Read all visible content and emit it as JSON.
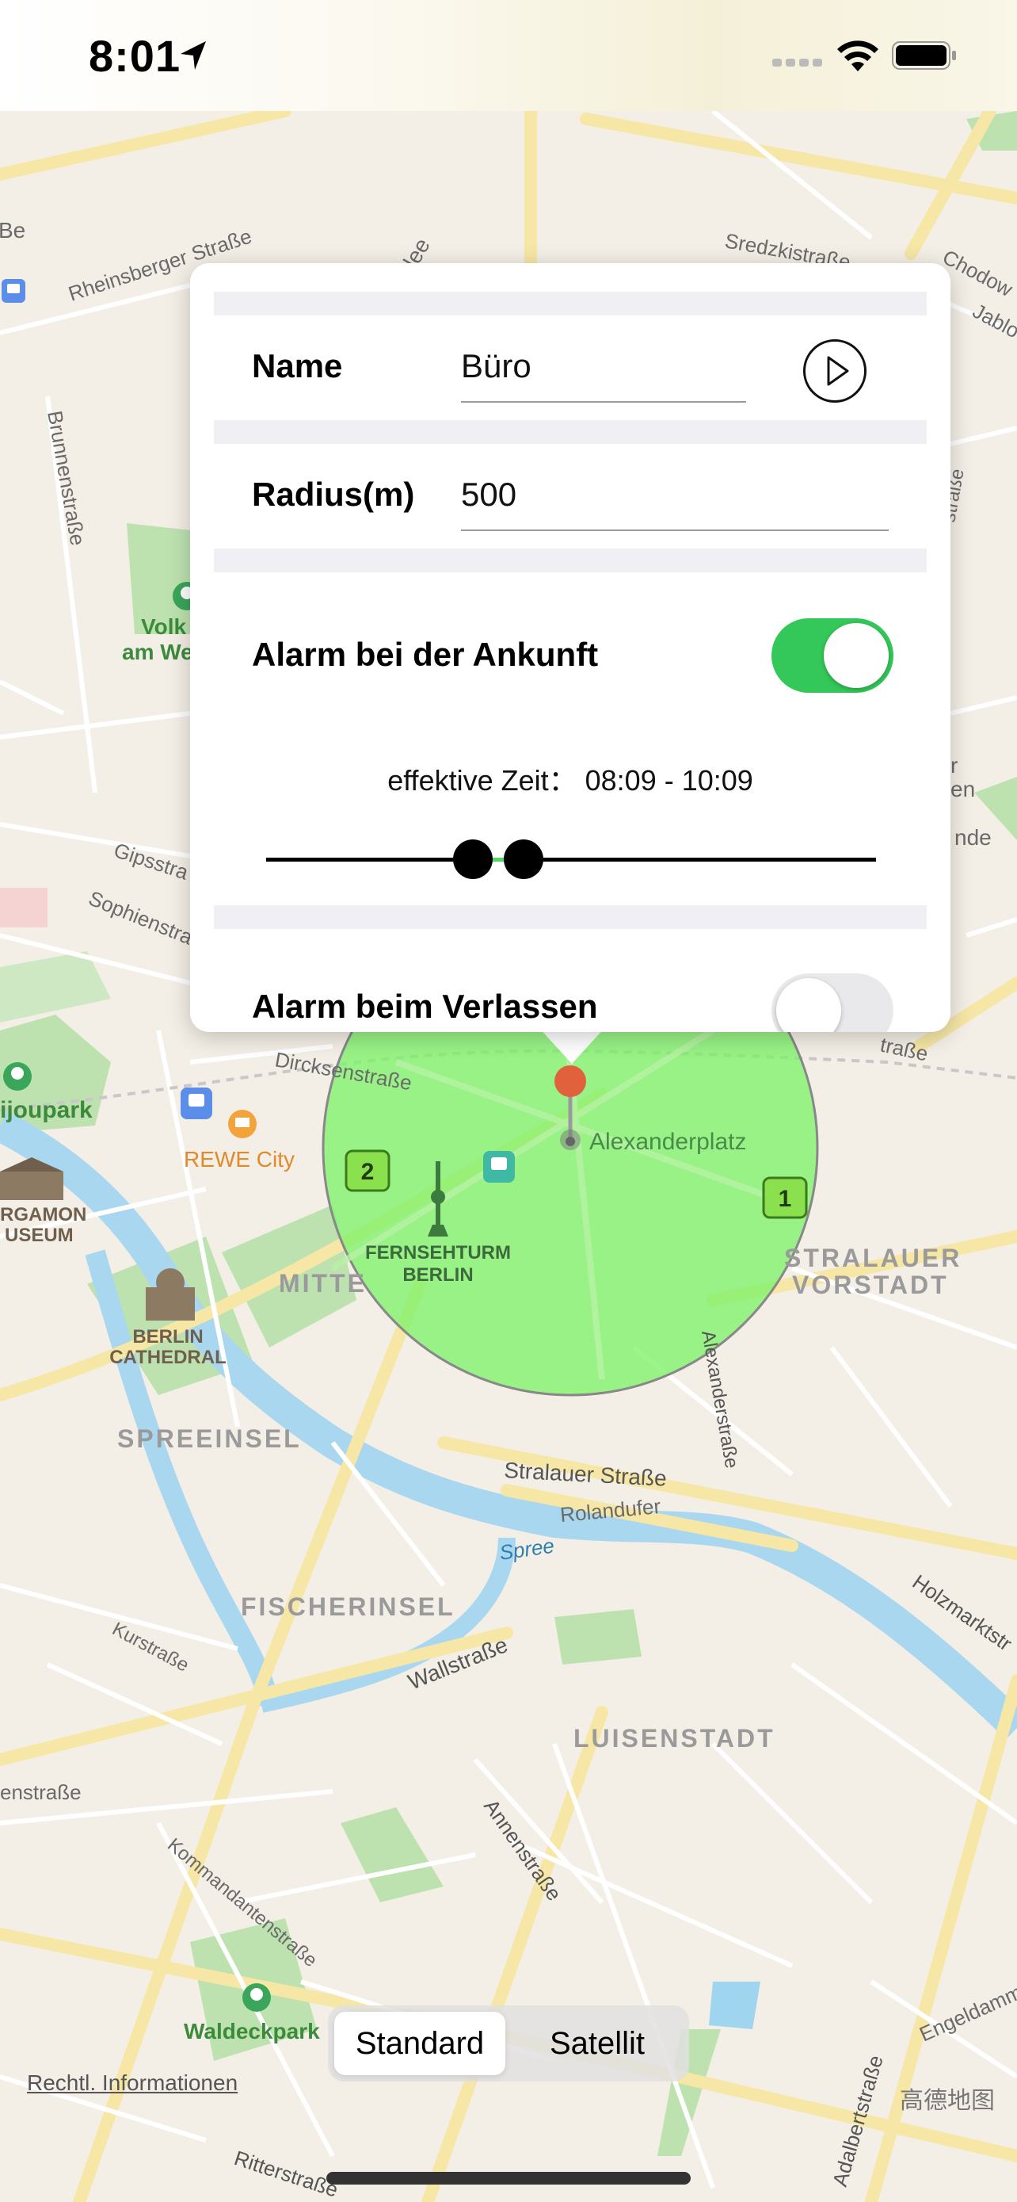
{
  "status_bar": {
    "time": "8:01"
  },
  "popup": {
    "name_label": "Name",
    "name_value": "Büro",
    "radius_label": "Radius(m)",
    "radius_value": "500",
    "arrival_label": "Alarm bei der Ankunft",
    "arrival_enabled": true,
    "effective_time": "effektive Zeit： 08:09 - 10:09",
    "departure_label": "Alarm beim Verlassen",
    "departure_enabled": false,
    "colors": {
      "toggle_on": "#34c759",
      "slider_fill": "#4cd964"
    }
  },
  "map": {
    "labels": {
      "rheinsberger": "Rheinsberger Straße",
      "sredzki": "Sredzkistraße",
      "chodo": "Chodow",
      "jablo": "Jablo",
      "brunnen": "Brunnenstraße",
      "volk1": "Volk",
      "volk2": "am We",
      "gips": "Gipsstra",
      "sophien": "Sophienstra",
      "dircksen": "Dircksenstraße",
      "monbijou": "ijoupark",
      "rewe": "REWE City",
      "alexanderplatz": "Alexanderplatz",
      "fernsehturm1": "FERNSEHTURM",
      "fernsehturm2": "BERLIN",
      "mitte": "MITTE",
      "stralauer_v1": "STRALAUER",
      "stralauer_v2": "VORSTADT",
      "pergamon1": "RGAMON",
      "pergamon2": "USEUM",
      "cathedral1": "BERLIN",
      "cathedral2": "CATHEDRAL",
      "spreeinsel": "SPREEINSEL",
      "stralauer_str": "Stralauer Straße",
      "rolandufer": "Rolandufer",
      "spree": "Spree",
      "alexanderstr": "Alexanderstraße",
      "fischerinsel": "FISCHERINSEL",
      "kurstr": "Kurstraße",
      "wallstr": "Wallstraße",
      "luisenstadt": "LUISENSTADT",
      "holzmarkt": "Holzmarktstr",
      "annenstr": "Annenstraße",
      "kommandanten": "Kommandantenstraße",
      "waldeckpark": "Waldeckpark",
      "engeldamm": "Engeldamm",
      "adalbert": "Adalbertstraße",
      "ritterstr": "Ritterstraße",
      "enstr": "enstraße",
      "stra_r": "straße",
      "nde": "nde",
      "r_en1": "r",
      "r_en2": "en",
      "be": "Be",
      "lee": "lee",
      "trasse_right": "traße",
      "amap": "高德地图"
    },
    "badge_1": "1",
    "badge_2": "2",
    "geofence_color": "#7ef26a"
  },
  "map_type": {
    "standard": "Standard",
    "satellite": "Satellit",
    "selected": "Standard"
  },
  "legal": "Rechtl. Informationen"
}
